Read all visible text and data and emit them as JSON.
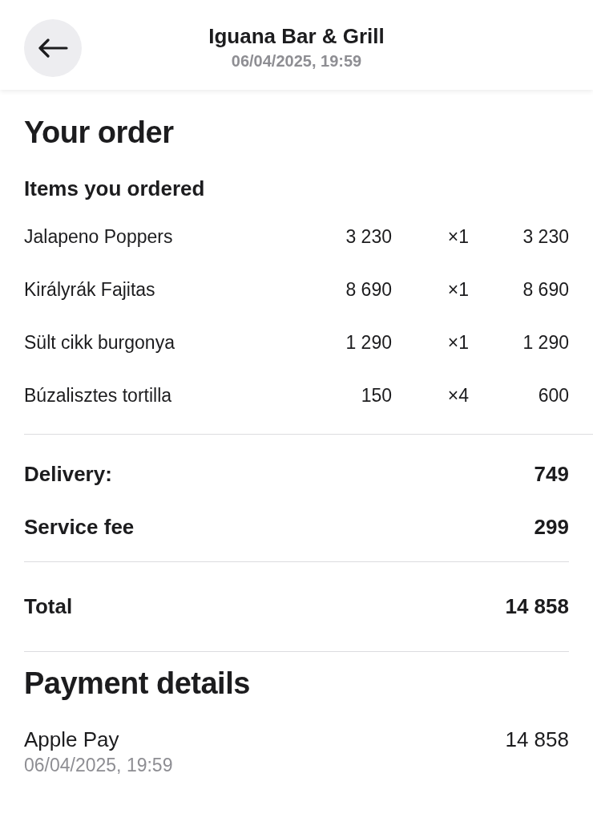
{
  "header": {
    "title": "Iguana Bar & Grill",
    "subtitle": "06/04/2025, 19:59"
  },
  "order": {
    "heading": "Your order",
    "items_heading": "Items you ordered",
    "items": [
      {
        "name": "Jalapeno Poppers",
        "price": "3 230",
        "quantity": "×1",
        "total": "3 230"
      },
      {
        "name": "Királyrák Fajitas",
        "price": "8 690",
        "quantity": "×1",
        "total": "8 690"
      },
      {
        "name": "Sült cikk burgonya",
        "price": "1 290",
        "quantity": "×1",
        "total": "1 290"
      },
      {
        "name": "Búzalisztes tortilla",
        "price": "150",
        "quantity": "×4",
        "total": "600"
      }
    ],
    "fees": [
      {
        "label": "Delivery:",
        "amount": "749"
      },
      {
        "label": "Service fee",
        "amount": "299"
      }
    ],
    "total": {
      "label": "Total",
      "amount": "14 858"
    }
  },
  "payment": {
    "heading": "Payment details",
    "method": "Apple Pay",
    "amount": "14 858",
    "date": "06/04/2025, 19:59"
  }
}
